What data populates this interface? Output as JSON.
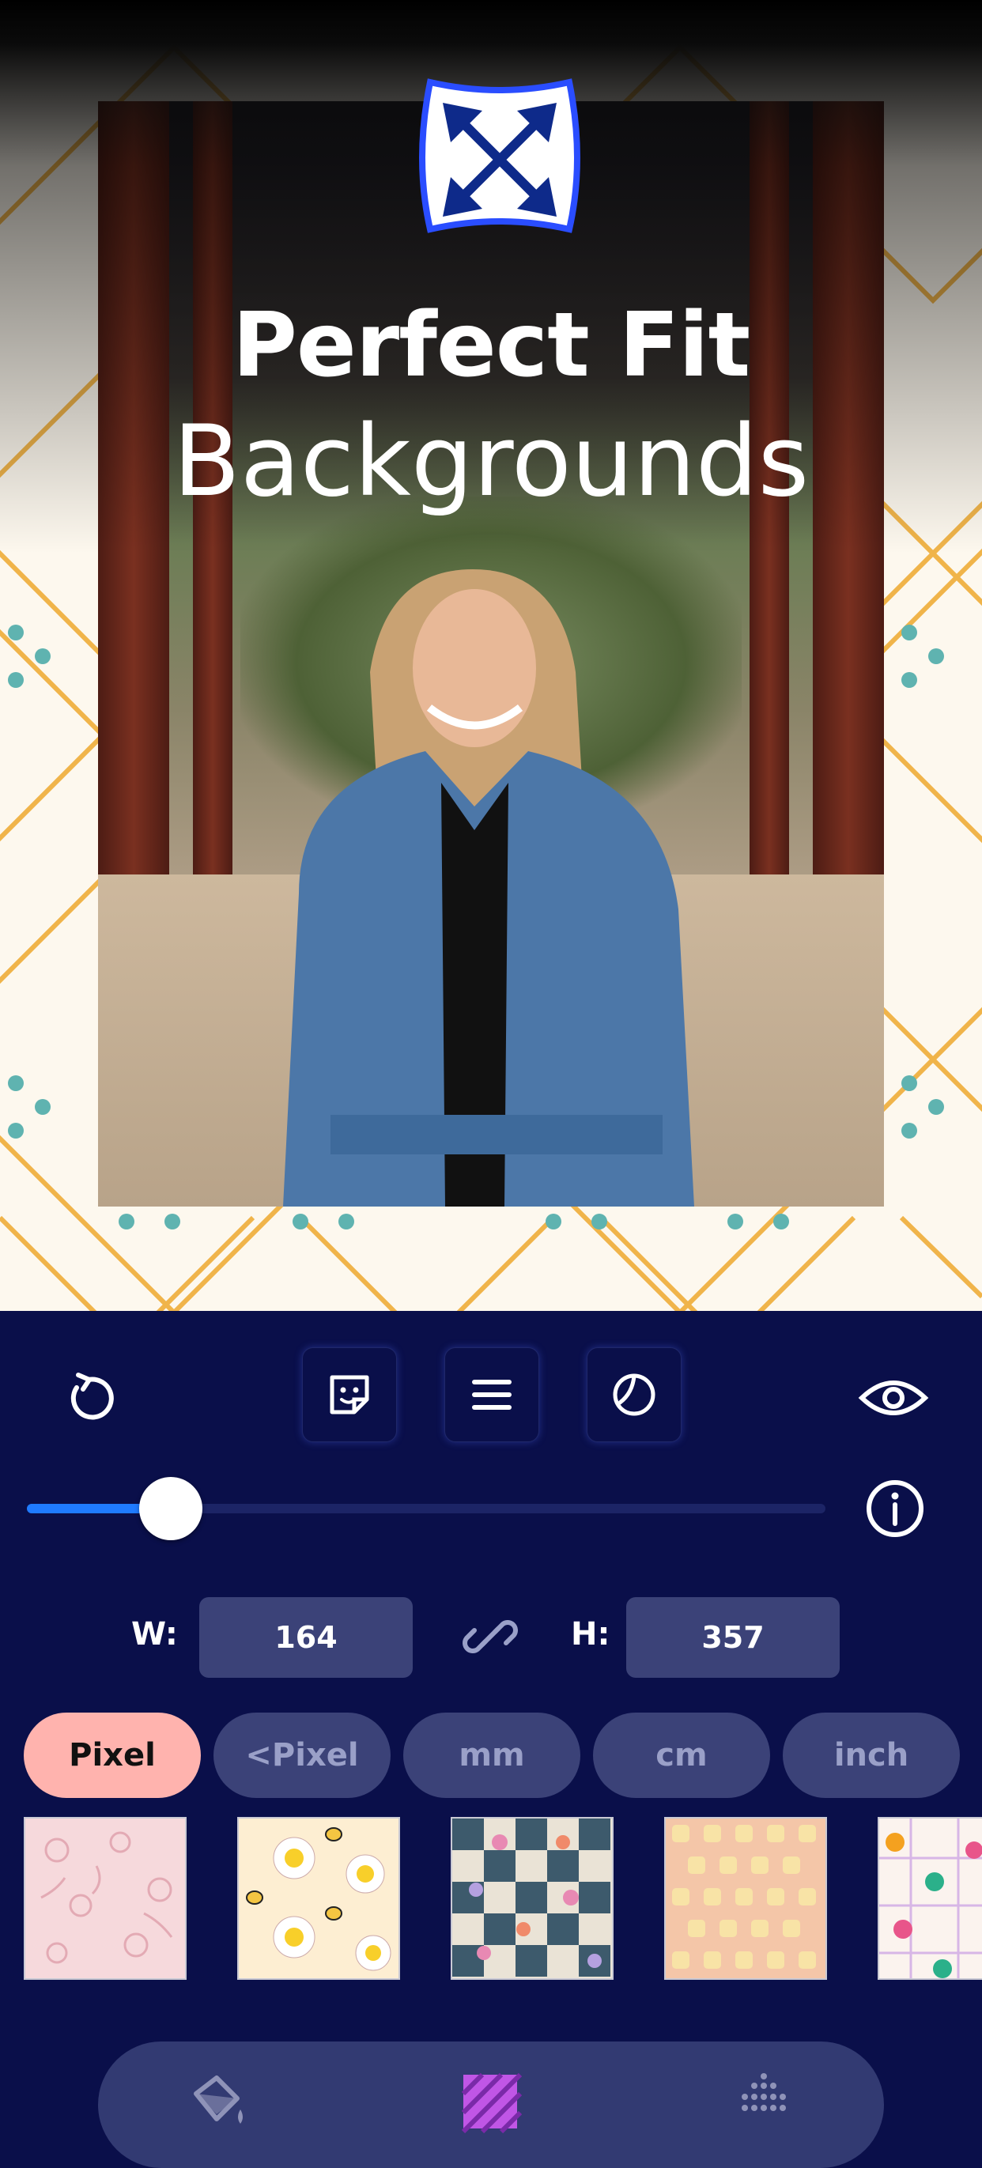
{
  "headline": {
    "line1": "Perfect Fit",
    "line2": "Backgrounds"
  },
  "toolbar": {
    "undo_icon": "undo-icon",
    "tools": [
      "sticker-icon",
      "menu-icon",
      "shape-icon"
    ],
    "preview_icon": "eye-icon"
  },
  "slider": {
    "value": 0.18,
    "info_icon": "info-icon"
  },
  "dimensions": {
    "width_label": "W:",
    "width_value": "164",
    "link_icon": "link-icon",
    "height_label": "H:",
    "height_value": "357"
  },
  "units": [
    {
      "label": "Pixel",
      "active": true
    },
    {
      "label": "<Pixel",
      "active": false
    },
    {
      "label": "mm",
      "active": false
    },
    {
      "label": "cm",
      "active": false
    },
    {
      "label": "inch",
      "active": false
    }
  ],
  "patterns": [
    "pink-floral",
    "daisy-bee",
    "wavy-checker",
    "pastel-grid",
    "colorful-stars"
  ],
  "bottom_nav": [
    "paint-bucket-icon",
    "pattern-icon",
    "dots-icon"
  ],
  "colors": {
    "panel": "#0a0f4a",
    "field": "#3b4278",
    "accent": "#1f7bff",
    "active_unit": "#ffb3ae"
  }
}
